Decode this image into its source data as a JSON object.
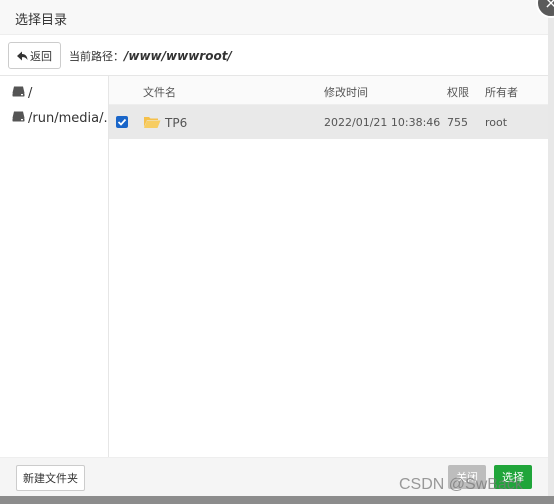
{
  "dialog": {
    "title": "选择目录",
    "close_glyph": "×"
  },
  "toolbar": {
    "back_label": "返回",
    "path_label": "当前路径：",
    "path_value": "/www/wwwroot/"
  },
  "sidebar": {
    "items": [
      {
        "label": "/",
        "icon": "drive-icon"
      },
      {
        "label": "/run/media/...",
        "icon": "drive-icon"
      }
    ]
  },
  "table": {
    "columns": [
      "文件名",
      "修改时间",
      "权限",
      "所有者"
    ],
    "rows": [
      {
        "checked": true,
        "icon": "folder-icon",
        "name": "TP6",
        "modified": "2022/01/21 10:38:46",
        "permission": "755",
        "owner": "root"
      }
    ]
  },
  "footer": {
    "new_folder_label": "新建文件夹",
    "close_label": "关闭",
    "select_label": "选择"
  },
  "watermark": "CSDN @SwBack",
  "colors": {
    "accent_green": "#20a53a",
    "checkbox_blue": "#1a66c9",
    "selected_row": "#e9e9e9",
    "disabled_button": "#bdbdbd"
  }
}
